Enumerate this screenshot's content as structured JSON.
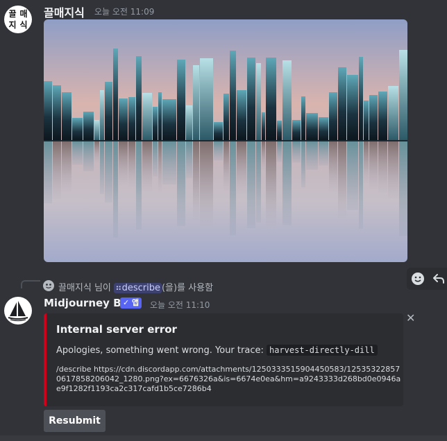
{
  "message1": {
    "avatar_chars": [
      "끌",
      "매",
      "지",
      "식"
    ],
    "username": "끌매지식",
    "timestamp": "오늘 오전 11:09",
    "image_alt_icon": "city-skyline-reflection-image"
  },
  "hover_actions": {
    "reaction_icon": "smile-emoji-icon",
    "reply_icon": "reply-arrow-icon"
  },
  "command_line": {
    "user": "끌매지식",
    "suffix_user": " 님이 ",
    "command": "describe",
    "suffix": "(을)를 사용함"
  },
  "message2": {
    "username": "Midjourney Bot",
    "badge": "✓ 앱",
    "timestamp": "오늘 오전 11:10",
    "embed": {
      "accent_color": "#d0021b",
      "title": "Internal server error",
      "description_prefix": "Apologies, something went wrong. Your trace: ",
      "trace": "harvest-directly-dill",
      "footer": "/describe https://cdn.discordapp.com/attachments/1250333515904450583/125353228570617858206042_1280.png?ex=6676326a&is=6674e0ea&hm=a9243333d268bd0e0946ae9f1282f1193ca2c317cafd1b5ce7286b4"
    },
    "close_label": "✕",
    "resubmit_label": "Resubmit"
  }
}
